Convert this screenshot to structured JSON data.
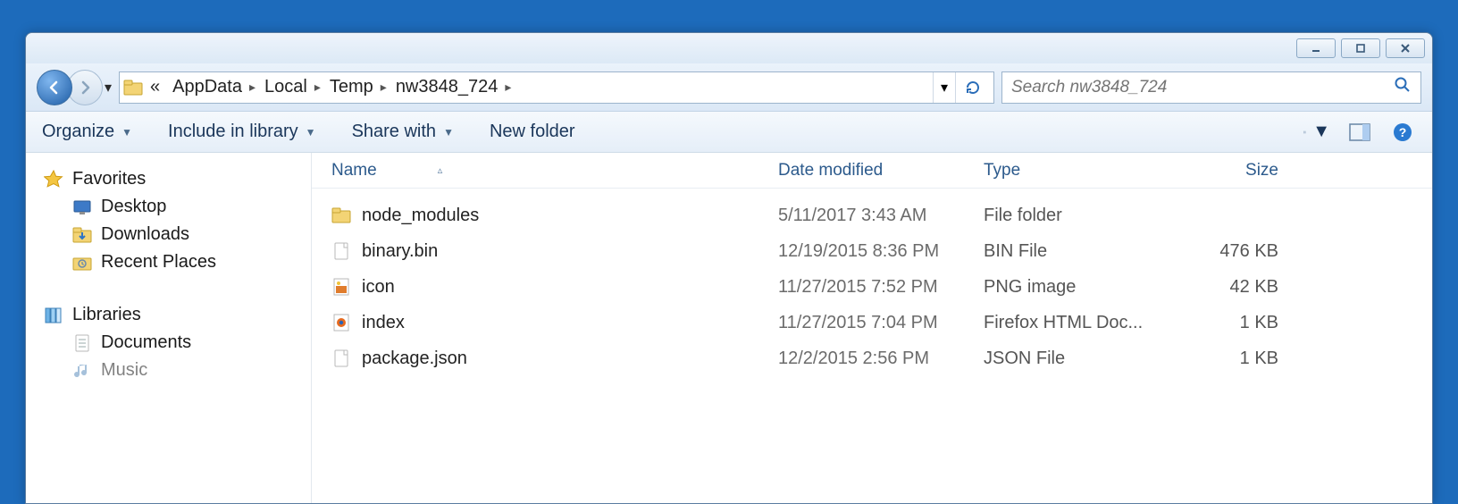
{
  "breadcrumbs": {
    "prefix": "«",
    "parts": [
      "AppData",
      "Local",
      "Temp",
      "nw3848_724"
    ]
  },
  "search": {
    "placeholder": "Search nw3848_724"
  },
  "toolbar": {
    "organize": "Organize",
    "include": "Include in library",
    "share": "Share with",
    "newfolder": "New folder"
  },
  "sidebar": {
    "favorites": {
      "label": "Favorites",
      "items": [
        {
          "label": "Desktop"
        },
        {
          "label": "Downloads"
        },
        {
          "label": "Recent Places"
        }
      ]
    },
    "libraries": {
      "label": "Libraries",
      "items": [
        {
          "label": "Documents"
        },
        {
          "label": "Music"
        }
      ]
    }
  },
  "columns": {
    "name": "Name",
    "date": "Date modified",
    "type": "Type",
    "size": "Size"
  },
  "files": [
    {
      "name": "node_modules",
      "date": "5/11/2017 3:43 AM",
      "type": "File folder",
      "size": "",
      "icon": "folder"
    },
    {
      "name": "binary.bin",
      "date": "12/19/2015 8:36 PM",
      "type": "BIN File",
      "size": "476 KB",
      "icon": "page"
    },
    {
      "name": "icon",
      "date": "11/27/2015 7:52 PM",
      "type": "PNG image",
      "size": "42 KB",
      "icon": "png"
    },
    {
      "name": "index",
      "date": "11/27/2015 7:04 PM",
      "type": "Firefox HTML Doc...",
      "size": "1 KB",
      "icon": "html"
    },
    {
      "name": "package.json",
      "date": "12/2/2015 2:56 PM",
      "type": "JSON File",
      "size": "1 KB",
      "icon": "page"
    }
  ]
}
